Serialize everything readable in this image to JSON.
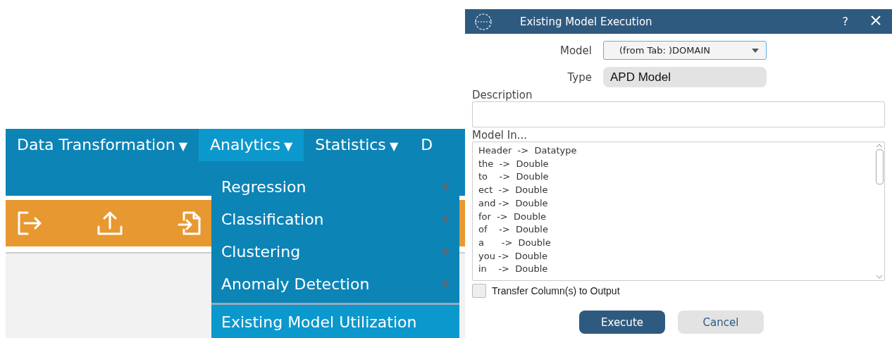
{
  "menu_bar": {
    "items": [
      {
        "label": "Data Transformation",
        "caret": "▼",
        "selected": false
      },
      {
        "label": "Analytics",
        "caret": "▼",
        "selected": true
      },
      {
        "label": "Statistics",
        "caret": "▼",
        "selected": false
      },
      {
        "label": "D",
        "selected": false
      }
    ]
  },
  "dropdown": {
    "items": [
      {
        "label": "Regression",
        "submenu": true,
        "highlighted": false
      },
      {
        "label": "Classification",
        "submenu": true,
        "highlighted": false
      },
      {
        "label": "Clustering",
        "submenu": true,
        "highlighted": false
      },
      {
        "label": "Anomaly Detection",
        "submenu": true,
        "highlighted": false
      },
      {
        "label": "Existing Model Utilization",
        "submenu": false,
        "highlighted": true
      }
    ]
  },
  "toolbar": {
    "icons": [
      {
        "kind": "export"
      },
      {
        "kind": "upload"
      },
      {
        "kind": "import"
      }
    ]
  },
  "dialog": {
    "title": "Existing Model Execution",
    "help": "?",
    "model_label": "Model",
    "model_value": "(from Tab: )DOMAIN",
    "type_label": "Type",
    "type_value": "APD Model",
    "description_label": "Description",
    "model_in_label": "Model In...",
    "model_in_lines": [
      "Header  ->  Datatype",
      "the  ->  Double",
      "to    ->  Double",
      "ect  ->  Double",
      "and ->  Double",
      "for  ->  Double",
      "of    ->  Double",
      "a      ->  Double",
      "you ->  Double",
      "in    ->  Double"
    ],
    "transfer": {
      "label": "Transfer Column(s) to Output",
      "checked": false
    },
    "buttons": [
      {
        "label": "Execute",
        "kind": "primary"
      },
      {
        "label": "Cancel",
        "kind": "secondary"
      }
    ]
  }
}
